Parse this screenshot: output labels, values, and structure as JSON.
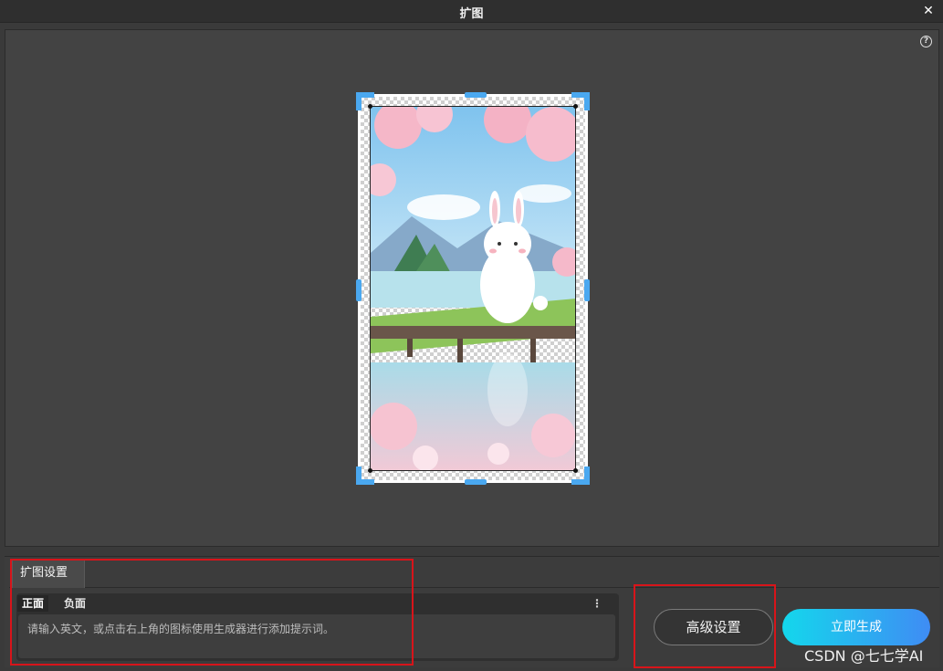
{
  "window": {
    "title": "扩图",
    "close_glyph": "✕"
  },
  "canvas": {
    "help_glyph": "?"
  },
  "panel": {
    "tab_label": "扩图设置",
    "prompt": {
      "positive_tab": "正面",
      "negative_tab": "负面",
      "menu_glyph": "⋮",
      "placeholder": "请输入英文，或点击右上角的图标使用生成器进行添加提示词。"
    },
    "advanced_button": "高级设置",
    "generate_button": "立即生成"
  },
  "watermark": "CSDN @七七学AI",
  "colors": {
    "accent_handle": "#4aa8f0",
    "generate_start": "#14d7ec",
    "generate_end": "#3f8cf4",
    "highlight_box": "#d8141a"
  },
  "icons": {
    "help": "help-icon",
    "close": "close-icon",
    "menu": "more-vertical-icon"
  }
}
